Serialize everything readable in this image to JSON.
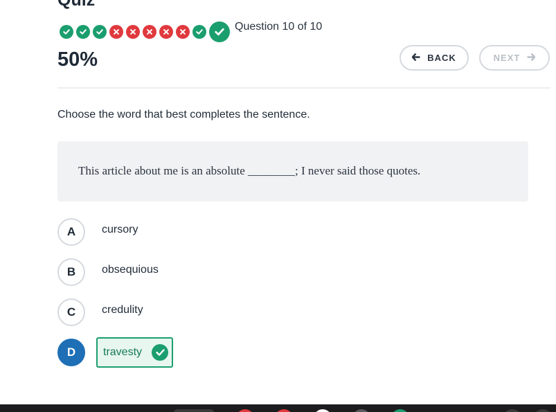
{
  "quiz": {
    "title": "Quiz",
    "progress": [
      "correct",
      "correct",
      "correct",
      "wrong",
      "wrong",
      "wrong",
      "wrong",
      "wrong",
      "correct",
      "correct"
    ],
    "question_counter": "Question 10 of 10",
    "score": "50%",
    "back_label": "BACK",
    "next_label": "NEXT"
  },
  "question": {
    "instruction": "Choose the word that best completes the sentence.",
    "sentence": "This article about me is an absolute ________; I never said those quotes."
  },
  "options": [
    {
      "letter": "A",
      "text": "cursory"
    },
    {
      "letter": "B",
      "text": "obsequious"
    },
    {
      "letter": "C",
      "text": "credulity"
    },
    {
      "letter": "D",
      "text": "travesty"
    }
  ],
  "colors": {
    "correct": "#1b9e6e",
    "wrong": "#e0393e",
    "selected": "#1e6fb5"
  }
}
